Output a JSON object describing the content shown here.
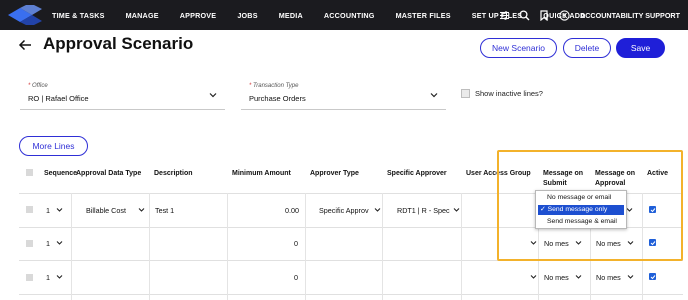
{
  "nav": {
    "items": [
      "TIME & TASKS",
      "MANAGE",
      "APPROVE",
      "JOBS",
      "MEDIA",
      "ACCOUNTING",
      "MASTER FILES",
      "SET UP FILES",
      "QUICK ADD"
    ],
    "account_name": "ACCOUNTABILITY SUPPORT",
    "icons": [
      "sliders-icon",
      "search-icon",
      "bookmark-icon",
      "help-icon"
    ]
  },
  "header": {
    "title": "Approval Scenario",
    "new_scenario_label": "New Scenario",
    "delete_label": "Delete",
    "save_label": "Save"
  },
  "filters": {
    "office_label": "Office",
    "office_value": "RO | Rafael Office",
    "transaction_label": "Transaction Type",
    "transaction_value": "Purchase Orders",
    "show_inactive_label": "Show inactive lines?",
    "required_mark": "*"
  },
  "more_lines_label": "More Lines",
  "table": {
    "headers": {
      "sequence": "Sequence",
      "approval_data_type": "Approval Data Type",
      "description": "Description",
      "minimum_amount": "Minimum Amount",
      "approver_type": "Approver Type",
      "specific_approver": "Specific Approver",
      "user_access_group": "User Access Group",
      "message_on_submit": "Message on Submit",
      "message_on_approval": "Message on Approval",
      "active": "Active"
    },
    "rows": [
      {
        "sequence": "1",
        "approval_data_type": "Billable Cost",
        "description": "Test 1",
        "minimum_amount": "0.00",
        "approver_type": "Specific Approv",
        "specific_approver": "RDT1 | R - Spec",
        "message_on_submit": "",
        "message_on_approval": "",
        "active": true
      },
      {
        "sequence": "1",
        "approval_data_type": "",
        "description": "",
        "minimum_amount": "0",
        "approver_type": "",
        "specific_approver": "",
        "message_on_submit": "No mes",
        "message_on_approval": "No mes",
        "active": true
      },
      {
        "sequence": "1",
        "approval_data_type": "",
        "description": "",
        "minimum_amount": "0",
        "approver_type": "",
        "specific_approver": "",
        "message_on_submit": "No mes",
        "message_on_approval": "No mes",
        "active": true
      }
    ]
  },
  "message_dropdown": {
    "options": [
      "No message or email",
      "Send message only",
      "Send message & email"
    ],
    "selected": "Send message only",
    "check_mark": "✓"
  },
  "colors": {
    "nav_bg": "#1b1b1f",
    "accent": "#1f1fd8",
    "highlight": "#f3b22b",
    "selected_option": "#1d4fd0"
  }
}
